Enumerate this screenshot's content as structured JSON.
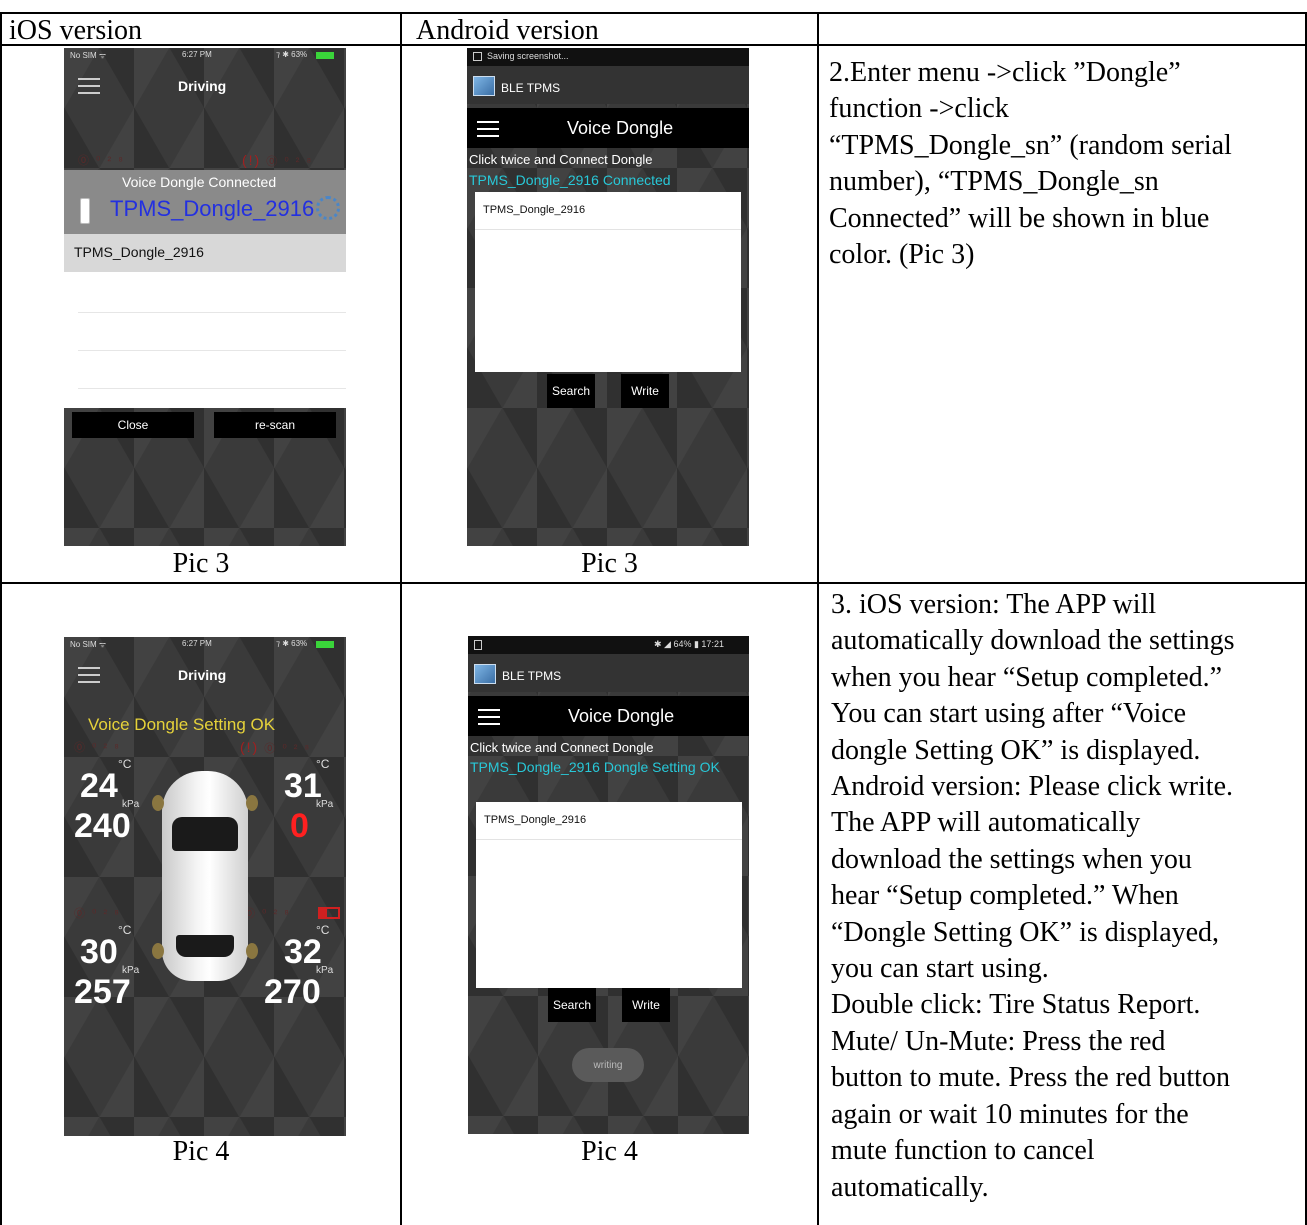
{
  "table": {
    "headers": [
      "iOS version",
      "Android version",
      ""
    ],
    "rows": [
      {
        "caption_ios": "Pic 3",
        "caption_android": "Pic 3",
        "description": "2.Enter menu ->click  ”Dongle”\nfunction ->click\n“TPMS_Dongle_sn” (random serial\nnumber), “TPMS_Dongle_sn\nConnected” will be shown in blue\ncolor. (Pic 3)"
      },
      {
        "caption_ios": "Pic 4",
        "caption_android": "Pic 4",
        "description": "3. iOS version: The APP will\nautomatically download the settings\nwhen you hear “Setup completed.”\nYou can start using after “Voice\ndongle Setting OK” is displayed.\nAndroid version: Please click write.\nThe APP will automatically\ndownload the settings when you\nhear “Setup completed.” When\n“Dongle Setting OK” is displayed,\nyou can start using.\nDouble click: Tire Status Report.\nMute/ Un-Mute: Press the red\nbutton to mute. Press the red button\nagain or wait 10 minutes for the\nmute function to cancel\nautomatically."
      }
    ]
  },
  "pic3_ios": {
    "status_carrier": "No SIM ᯤ",
    "status_time": "6:27 PM",
    "status_battery": "⁊ ✱ 63%",
    "title": "Driving",
    "connected_label": "Voice Dongle Connected",
    "device_name": "TPMS_Dongle_2916",
    "list_item": "TPMS_Dongle_2916",
    "close_button": "Close",
    "rescan_button": "re-scan",
    "colors": {
      "device_name": "#2330e0",
      "status_ok": "#e6d23a"
    }
  },
  "pic3_android": {
    "notification": "Saving screenshot...",
    "app_name": "BLE TPMS",
    "title": "Voice Dongle",
    "instruction": "Click twice and Connect Dongle",
    "status": "TPMS_Dongle_2916 Connected",
    "list_item": "TPMS_Dongle_2916",
    "search_button": "Search",
    "write_button": "Write",
    "colors": {
      "status": "#28c8d8"
    }
  },
  "pic4_ios": {
    "status_carrier": "No SIM ᯤ",
    "status_time": "6:27 PM",
    "status_battery": "⁊ ✱ 63%",
    "title": "Driving",
    "setting_ok": "Voice Dongle Setting OK",
    "tires": {
      "front_left": {
        "temp": "24",
        "pressure": "240"
      },
      "front_right": {
        "temp": "31",
        "pressure": "0"
      },
      "rear_left": {
        "temp": "30",
        "pressure": "257"
      },
      "rear_right": {
        "temp": "32",
        "pressure": "270"
      }
    },
    "temp_unit": "°C",
    "pressure_unit": "kPa",
    "colors": {
      "setting_ok": "#e6d23a",
      "alarm": "#ff2020"
    }
  },
  "pic4_android": {
    "status_right": "✱ ◢ 64% ▮ 17:21",
    "app_name": "BLE TPMS",
    "title": "Voice Dongle",
    "instruction": "Click twice and Connect Dongle",
    "status": "TPMS_Dongle_2916 Dongle Setting OK",
    "list_item": "TPMS_Dongle_2916",
    "search_button": "Search",
    "write_button": "Write",
    "writing_button": "writing",
    "colors": {
      "status": "#28c8d8"
    }
  }
}
